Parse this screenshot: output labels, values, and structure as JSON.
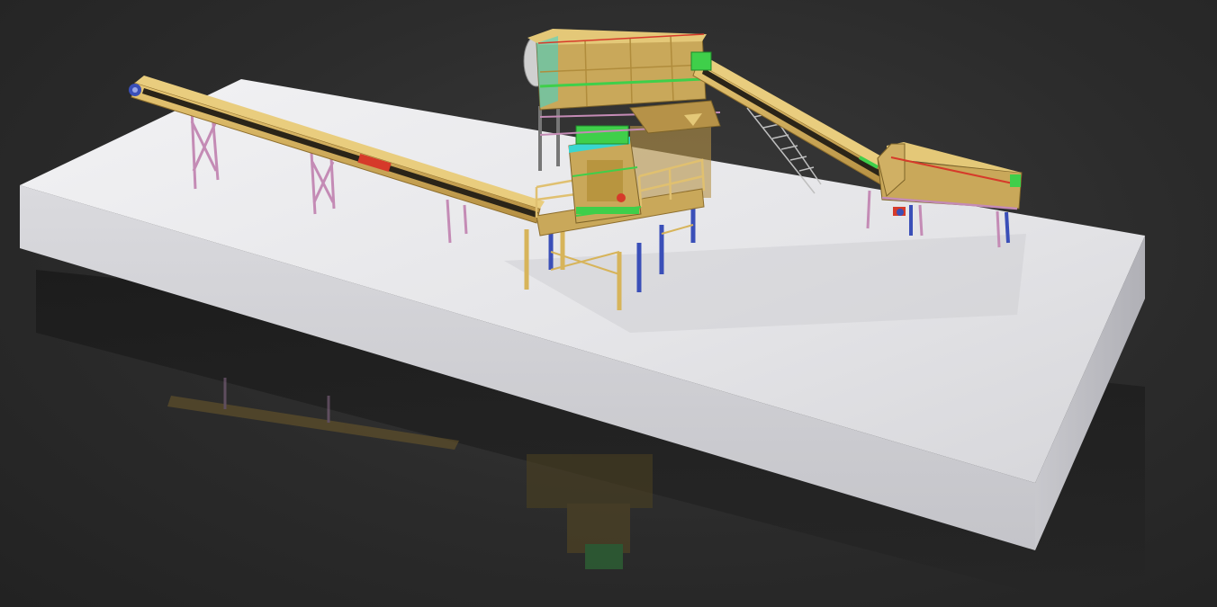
{
  "scene": {
    "subject": "3d-render-crushing-plant",
    "colors": {
      "background": "#2d2d2d",
      "platform_top": "#e6e6e8",
      "platform_front": "#d2d2d6",
      "platform_side": "#bdbdc2",
      "steel_yellow": "#d7b45a",
      "steel_yellow_dark": "#a8853a",
      "belt": "#2a2418",
      "brace_pink": "#c48bb5",
      "brace_blue": "#3a4fb8",
      "accent_green": "#3fcf4a",
      "accent_red": "#d63a2a",
      "accent_cyan": "#3ad6d0",
      "hopper_olive": "#c9a85a"
    }
  }
}
